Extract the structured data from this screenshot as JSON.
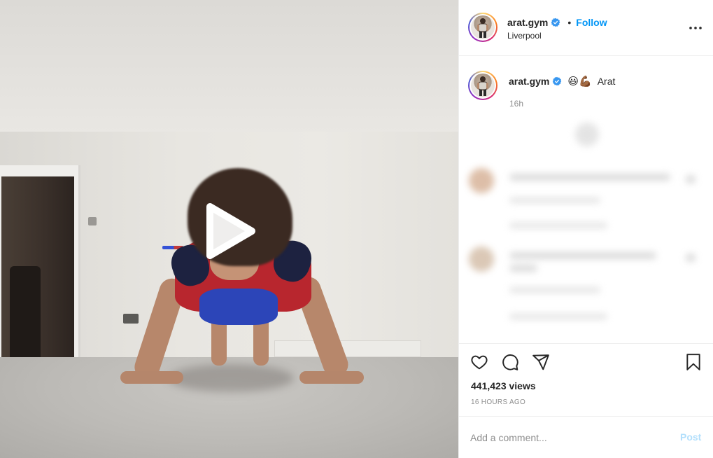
{
  "post": {
    "username": "arat.gym",
    "verified": true,
    "separator": "•",
    "follow_label": "Follow",
    "location": "Liverpool",
    "more_icon": "more-horizontal-icon"
  },
  "media": {
    "type": "video",
    "play_icon": "play-icon"
  },
  "caption": {
    "username": "arat.gym",
    "emoji": "😃💪🏾",
    "text": "Arat",
    "time": "16h"
  },
  "actions": {
    "like_icon": "heart-icon",
    "comment_icon": "comment-bubble-icon",
    "share_icon": "paper-plane-icon",
    "save_icon": "bookmark-icon",
    "views": "441,423 views",
    "timestamp": "16 HOURS AGO"
  },
  "comment_box": {
    "placeholder": "Add a comment...",
    "post_label": "Post"
  },
  "colors": {
    "link": "#0095f6",
    "post_disabled": "#b2dffc",
    "muted": "#8e8e8e",
    "text": "#262626"
  }
}
